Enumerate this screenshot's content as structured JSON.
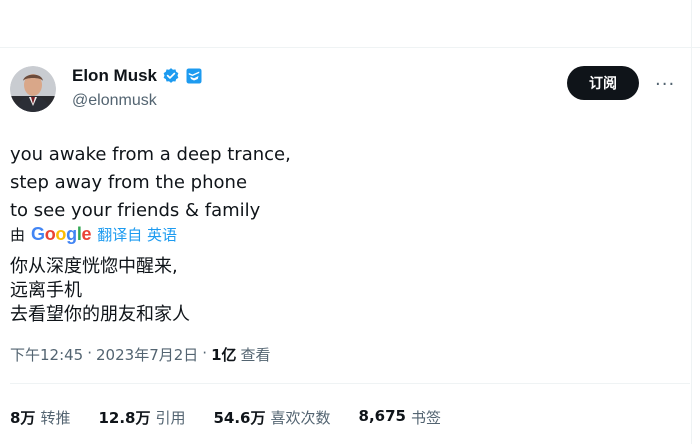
{
  "author": {
    "display_name": "Elon Musk",
    "handle": "@elonmusk",
    "verified_icon": "verified-badge-icon",
    "affiliation_icon": "gov-badge-icon"
  },
  "actions": {
    "subscribe_label": "订阅",
    "more_label": "···"
  },
  "tweet": {
    "lines": [
      "you awake from a deep trance,",
      "step away from the phone",
      "to see your friends & family"
    ],
    "translation": {
      "by_label": "由",
      "provider": "Google",
      "from_label": "翻译自 英语",
      "lines": [
        "你从深度恍惚中醒来,",
        "远离手机",
        "去看望你的朋友和家人"
      ]
    }
  },
  "meta": {
    "time": "下午12:45",
    "sep1": "·",
    "date": "2023年7月2日",
    "sep2": "·",
    "views": "1亿",
    "views_label": "查看"
  },
  "stats": [
    {
      "value": "8万",
      "label": "转推"
    },
    {
      "value": "12.8万",
      "label": "引用"
    },
    {
      "value": "54.6万",
      "label": "喜欢次数"
    },
    {
      "value": "8,675",
      "label": "书签"
    }
  ],
  "colors": {
    "accent": "#1d9bf0",
    "text": "#0f1419",
    "secondary": "#536471"
  }
}
